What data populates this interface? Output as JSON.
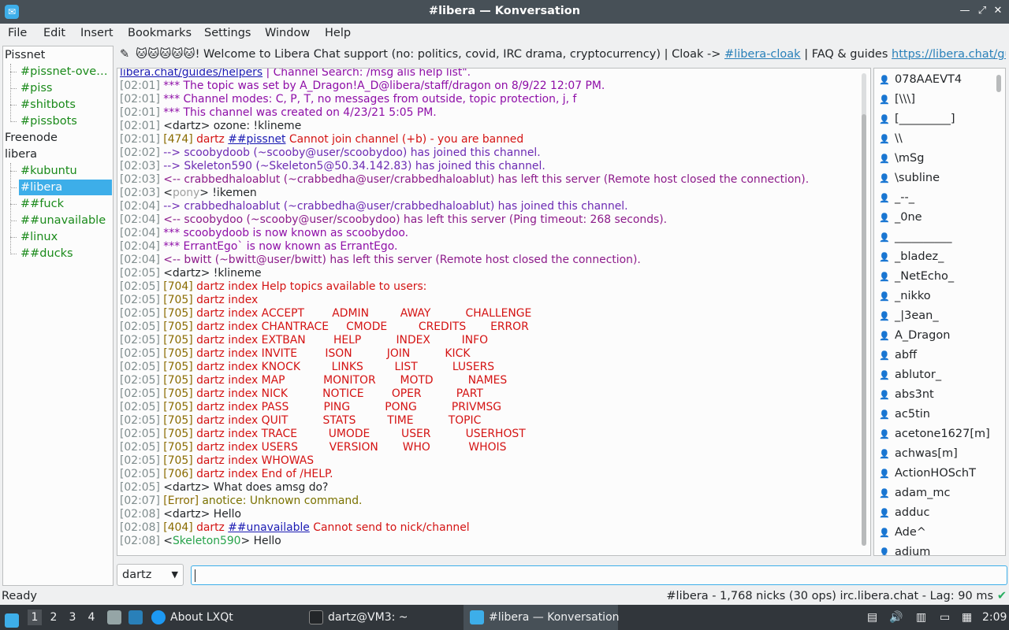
{
  "window": {
    "title": "#libera — Konversation"
  },
  "menu": [
    "File",
    "Edit",
    "Insert",
    "Bookmarks",
    "Settings",
    "Window",
    "Help"
  ],
  "tree": {
    "servers": [
      {
        "name": "Pissnet",
        "channels": [
          "#pissnet-over…",
          "#piss",
          "#shitbots",
          "#pissbots"
        ]
      },
      {
        "name": "Freenode",
        "channels": []
      },
      {
        "name": "libera",
        "channels": [
          "#kubuntu",
          "#libera",
          "##fuck",
          "##unavailable",
          "#linux",
          "##ducks"
        ]
      }
    ],
    "selected": "#libera"
  },
  "topic": {
    "pre": "🐱🐱🐱🐱🐱! Welcome to Libera Chat support (no: politics, covid, IRC drama, cryptocurrency) | Cloak -> ",
    "link1": "#libera-cloak",
    "mid": " | FAQ & guides ",
    "link2": "https://libera.chat/guides/fa..."
  },
  "chat": {
    "wrap": {
      "link": "libera.chat/guides/helpers",
      "rest": " | Channel Search: /msg alis help list\"."
    },
    "lines": [
      {
        "ts": "[02:01]",
        "parts": [
          {
            "t": "*** The topic was set by A_Dragon!A_D@libera/staff/dragon on 8/9/22 12:07 PM.",
            "c": "c-topic"
          }
        ]
      },
      {
        "ts": "[02:01]",
        "parts": [
          {
            "t": "*** Channel modes: C, P, T, no messages from outside, topic protection, j, f",
            "c": "c-topic"
          }
        ]
      },
      {
        "ts": "[02:01]",
        "parts": [
          {
            "t": "*** This channel was created on 4/23/21 5:05 PM.",
            "c": "c-topic"
          }
        ]
      },
      {
        "ts": "[02:01]",
        "parts": [
          {
            "t": "<dartz> ozone: !klineme",
            "c": "c-user"
          }
        ]
      },
      {
        "ts": "[02:01]",
        "parts": [
          {
            "t": "[474]",
            "c": "c-num"
          },
          {
            "t": " dartz ",
            "c": "c-err"
          },
          {
            "t": "##pissnet",
            "c": "c-uline"
          },
          {
            "t": " Cannot join channel (+b) - you are banned",
            "c": "c-err"
          }
        ]
      },
      {
        "ts": "[02:02]",
        "parts": [
          {
            "t": "--> scoobydoob (~scooby@user/scoobydoo) has joined this channel.",
            "c": "c-join"
          }
        ]
      },
      {
        "ts": "[02:03]",
        "parts": [
          {
            "t": "--> Skeleton590 (~Skeleton5@50.34.142.83) has joined this channel.",
            "c": "c-join"
          }
        ]
      },
      {
        "ts": "[02:03]",
        "parts": [
          {
            "t": "<-- crabbedhaloablut (~crabbedha@user/crabbedhaloablut) has left this server (Remote host closed the connection).",
            "c": "c-part"
          }
        ]
      },
      {
        "ts": "[02:03]",
        "parts": [
          {
            "t": "<",
            "c": "c-user"
          },
          {
            "t": "pony",
            "c": "nickgrey"
          },
          {
            "t": "> !ikemen",
            "c": "c-user"
          }
        ]
      },
      {
        "ts": "[02:04]",
        "parts": [
          {
            "t": "--> crabbedhaloablut (~crabbedha@user/crabbedhaloablut) has joined this channel.",
            "c": "c-join"
          }
        ]
      },
      {
        "ts": "[02:04]",
        "parts": [
          {
            "t": "<-- scoobydoo (~scooby@user/scoobydoo) has left this server (Ping timeout: 268 seconds).",
            "c": "c-part"
          }
        ]
      },
      {
        "ts": "[02:04]",
        "parts": [
          {
            "t": "*** scoobydoob is now known as scoobydoo.",
            "c": "c-nick"
          }
        ]
      },
      {
        "ts": "[02:04]",
        "parts": [
          {
            "t": "*** ErrantEgo` is now known as ErrantEgo.",
            "c": "c-nick"
          }
        ]
      },
      {
        "ts": "[02:04]",
        "parts": [
          {
            "t": "<-- bwitt (~bwitt@user/bwitt) has left this server (Remote host closed the connection).",
            "c": "c-part"
          }
        ]
      },
      {
        "ts": "[02:05]",
        "parts": [
          {
            "t": "<dartz> !klineme",
            "c": "c-user"
          }
        ]
      },
      {
        "ts": "[02:05]",
        "parts": [
          {
            "t": "[704]",
            "c": "c-num"
          },
          {
            "t": " dartz index Help topics available to users:",
            "c": "c-err"
          }
        ]
      },
      {
        "ts": "[02:05]",
        "parts": [
          {
            "t": "[705]",
            "c": "c-num"
          },
          {
            "t": " dartz index",
            "c": "c-err"
          }
        ]
      },
      {
        "ts": "[02:05]",
        "parts": [
          {
            "t": "[705]",
            "c": "c-num"
          },
          {
            "t": " dartz index ACCEPT        ADMIN         AWAY          CHALLENGE",
            "c": "c-err"
          }
        ]
      },
      {
        "ts": "[02:05]",
        "parts": [
          {
            "t": "[705]",
            "c": "c-num"
          },
          {
            "t": " dartz index CHANTRACE     CMODE         CREDITS       ERROR",
            "c": "c-err"
          }
        ]
      },
      {
        "ts": "[02:05]",
        "parts": [
          {
            "t": "[705]",
            "c": "c-num"
          },
          {
            "t": " dartz index EXTBAN        HELP          INDEX         INFO",
            "c": "c-err"
          }
        ]
      },
      {
        "ts": "[02:05]",
        "parts": [
          {
            "t": "[705]",
            "c": "c-num"
          },
          {
            "t": " dartz index INVITE        ISON          JOIN          KICK",
            "c": "c-err"
          }
        ]
      },
      {
        "ts": "[02:05]",
        "parts": [
          {
            "t": "[705]",
            "c": "c-num"
          },
          {
            "t": " dartz index KNOCK         LINKS         LIST          LUSERS",
            "c": "c-err"
          }
        ]
      },
      {
        "ts": "[02:05]",
        "parts": [
          {
            "t": "[705]",
            "c": "c-num"
          },
          {
            "t": " dartz index MAP           MONITOR       MOTD          NAMES",
            "c": "c-err"
          }
        ]
      },
      {
        "ts": "[02:05]",
        "parts": [
          {
            "t": "[705]",
            "c": "c-num"
          },
          {
            "t": " dartz index NICK          NOTICE        OPER          PART",
            "c": "c-err"
          }
        ]
      },
      {
        "ts": "[02:05]",
        "parts": [
          {
            "t": "[705]",
            "c": "c-num"
          },
          {
            "t": " dartz index PASS          PING          PONG          PRIVMSG",
            "c": "c-err"
          }
        ]
      },
      {
        "ts": "[02:05]",
        "parts": [
          {
            "t": "[705]",
            "c": "c-num"
          },
          {
            "t": " dartz index QUIT          STATS         TIME          TOPIC",
            "c": "c-err"
          }
        ]
      },
      {
        "ts": "[02:05]",
        "parts": [
          {
            "t": "[705]",
            "c": "c-num"
          },
          {
            "t": " dartz index TRACE         UMODE         USER          USERHOST",
            "c": "c-err"
          }
        ]
      },
      {
        "ts": "[02:05]",
        "parts": [
          {
            "t": "[705]",
            "c": "c-num"
          },
          {
            "t": " dartz index USERS         VERSION       WHO           WHOIS",
            "c": "c-err"
          }
        ]
      },
      {
        "ts": "[02:05]",
        "parts": [
          {
            "t": "[705]",
            "c": "c-num"
          },
          {
            "t": " dartz index WHOWAS",
            "c": "c-err"
          }
        ]
      },
      {
        "ts": "[02:05]",
        "parts": [
          {
            "t": "[706]",
            "c": "c-num"
          },
          {
            "t": " dartz index End of /HELP.",
            "c": "c-err"
          }
        ]
      },
      {
        "ts": "[02:05]",
        "parts": [
          {
            "t": "<dartz> What does amsg do?",
            "c": "c-user"
          }
        ]
      },
      {
        "ts": "[02:07]",
        "parts": [
          {
            "t": "[Error]",
            "c": "c-num"
          },
          {
            "t": " anotice: Unknown command.",
            "c": "c-err2"
          }
        ]
      },
      {
        "ts": "[02:08]",
        "parts": [
          {
            "t": "<dartz> Hello",
            "c": "c-user"
          }
        ]
      },
      {
        "ts": "[02:08]",
        "parts": [
          {
            "t": "[404]",
            "c": "c-num"
          },
          {
            "t": " dartz ",
            "c": "c-err"
          },
          {
            "t": "##unavailable",
            "c": "c-uline"
          },
          {
            "t": " Cannot send to nick/channel",
            "c": "c-err"
          }
        ]
      },
      {
        "ts": "[02:08]",
        "parts": [
          {
            "t": "<",
            "c": "c-user"
          },
          {
            "t": "Skeleton590",
            "c": "nickgreen"
          },
          {
            "t": "> Hello",
            "c": "c-user"
          }
        ]
      }
    ]
  },
  "nicks": [
    "078AAEVT4",
    "[\\\\\\]",
    "[_________]",
    "\\\\",
    "\\mSg",
    "\\subline",
    "_--_",
    "_0ne",
    "__________",
    "_bladez_",
    "_NetEcho_",
    "_nikko",
    "_|3ean_",
    "A_Dragon",
    "abff",
    "ablutor_",
    "abs3nt",
    "ac5tin",
    "acetone1627[m]",
    "achwas[m]",
    "ActionHOSchT",
    "adam_mc",
    "adduc",
    "Ade^",
    "adium"
  ],
  "input": {
    "nick": "dartz",
    "value": ""
  },
  "status": {
    "left": "Ready",
    "right": "#libera - 1,768 nicks (30 ops)  irc.libera.chat - Lag: 90 ms"
  },
  "taskbar": {
    "workspaces": [
      "1",
      "2",
      "3",
      "4"
    ],
    "tasks": [
      "About LXQt",
      "dartz@VM3: ~",
      "#libera — Konversation"
    ],
    "clock": "2:09"
  }
}
